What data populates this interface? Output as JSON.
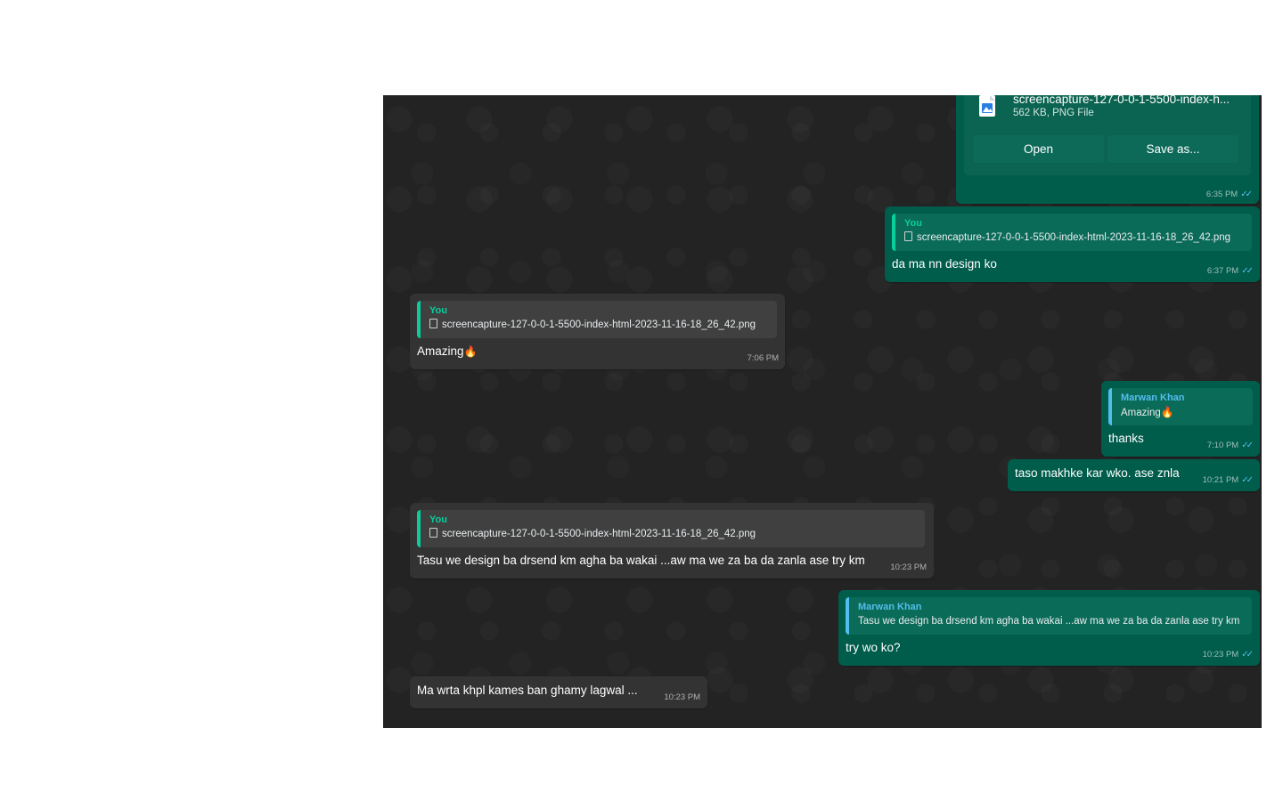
{
  "file_message": {
    "file_name": "screencapture-127-0-0-1-5500-index-h...",
    "file_info": "562 KB, PNG File",
    "open_label": "Open",
    "save_label": "Save as...",
    "time": "6:35 PM"
  },
  "messages": [
    {
      "direction": "outgoing",
      "quote_author": "You",
      "quote_text": "screencapture-127-0-0-1-5500-index-html-2023-11-16-18_26_42.png",
      "text": "da ma nn design ko",
      "time": "6:37 PM"
    },
    {
      "direction": "incoming",
      "quote_author": "You",
      "quote_text": "screencapture-127-0-0-1-5500-index-html-2023-11-16-18_26_42.png",
      "text": "Amazing",
      "emoji": "🔥",
      "time": "7:06 PM"
    },
    {
      "direction": "outgoing",
      "quote_author": "Marwan Khan",
      "quote_text": "Amazing",
      "quote_emoji": "🔥",
      "text": "thanks",
      "time": "7:10 PM"
    },
    {
      "direction": "outgoing",
      "text": "taso makhke kar wko. ase znla",
      "time": "10:21 PM"
    },
    {
      "direction": "incoming",
      "quote_author": "You",
      "quote_text": "screencapture-127-0-0-1-5500-index-html-2023-11-16-18_26_42.png",
      "text": "Tasu we design ba drsend km agha ba wakai ...aw ma we za ba da zanla ase try km",
      "time": "10:23 PM"
    },
    {
      "direction": "outgoing",
      "quote_author": "Marwan Khan",
      "quote_text": "Tasu we design ba drsend km agha ba wakai ...aw ma we za ba da zanla ase try km",
      "text": "try wo ko?",
      "time": "10:23 PM"
    },
    {
      "direction": "incoming",
      "text": "Ma wrta khpl kames ban ghamy lagwal ...",
      "time": "10:23 PM"
    }
  ],
  "colors": {
    "outgoing_bubble": "#005c4b",
    "incoming_bubble": "#333333",
    "chat_background": "#232323",
    "read_tick": "#53bdeb",
    "quote_self": "#06cf9c",
    "quote_other": "#53bdeb"
  },
  "icons": {
    "file": "image-file-icon",
    "document": "document-icon",
    "read_receipt": "double-check-icon"
  }
}
